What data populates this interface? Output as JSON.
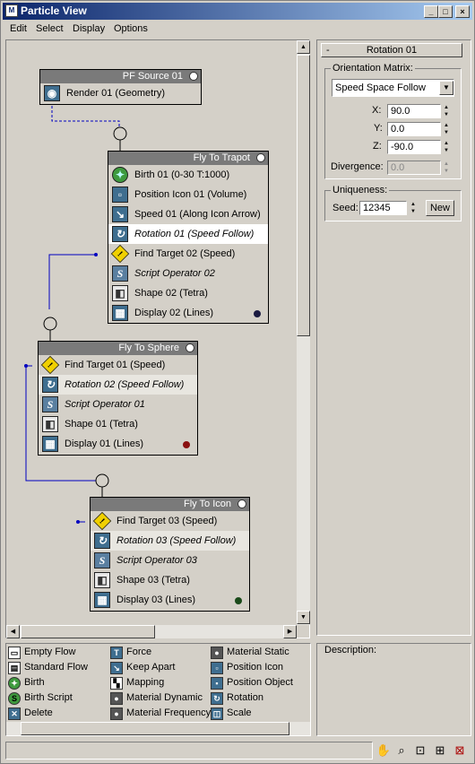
{
  "window": {
    "title": "Particle View"
  },
  "menu": [
    "Edit",
    "Select",
    "Display",
    "Options"
  ],
  "nodes": {
    "source": {
      "title": "PF Source 01",
      "ops": [
        "Render 01 (Geometry)"
      ]
    },
    "trapot": {
      "title": "Fly To Trapot",
      "ops": [
        "Birth 01 (0-30 T:1000)",
        "Position Icon 01 (Volume)",
        "Speed 01 (Along Icon Arrow)",
        "Rotation 01 (Speed Follow)",
        "Find Target 02 (Speed)",
        "Script Operator 02",
        "Shape 02 (Tetra)",
        "Display 02 (Lines)"
      ]
    },
    "sphere": {
      "title": "Fly To Sphere",
      "ops": [
        "Find Target 01 (Speed)",
        "Rotation 02 (Speed Follow)",
        "Script Operator 01",
        "Shape 01 (Tetra)",
        "Display 01 (Lines)"
      ]
    },
    "icon": {
      "title": "Fly To Icon",
      "ops": [
        "Find Target 03 (Speed)",
        "Rotation 03 (Speed Follow)",
        "Script Operator 03",
        "Shape 03 (Tetra)",
        "Display 03 (Lines)"
      ]
    }
  },
  "display_colors": {
    "trapot": "#1a1a40",
    "sphere": "#8a1010",
    "icon": "#1a4a1a"
  },
  "params": {
    "rollout_title": "Rotation 01",
    "orientation_label": "Orientation Matrix:",
    "orientation_value": "Speed Space Follow",
    "x_label": "X:",
    "x": "90.0",
    "y_label": "Y:",
    "y": "0.0",
    "z_label": "Z:",
    "z": "-90.0",
    "divergence_label": "Divergence:",
    "divergence": "0.0",
    "uniqueness_label": "Uniqueness:",
    "seed_label": "Seed:",
    "seed": "12345",
    "new_button": "New"
  },
  "depot": {
    "col1": [
      "Empty Flow",
      "Standard Flow",
      "Birth",
      "Birth Script",
      "Delete"
    ],
    "col2": [
      "Force",
      "Keep Apart",
      "Mapping",
      "Material Dynamic",
      "Material Frequency"
    ],
    "col3": [
      "Material Static",
      "Position Icon",
      "Position Object",
      "Rotation",
      "Scale"
    ]
  },
  "description_label": "Description:"
}
